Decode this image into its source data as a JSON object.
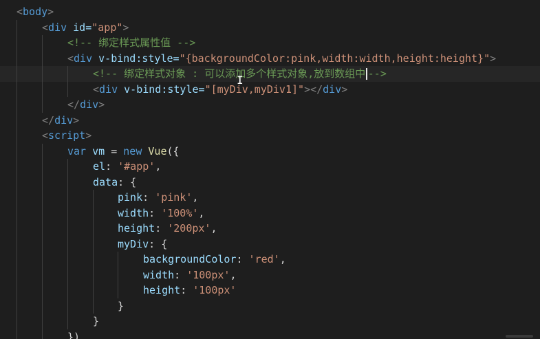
{
  "editor": {
    "lines": [
      {
        "tokens": [
          "<",
          "body",
          ">"
        ]
      },
      {
        "tokens": [
          "<",
          "div",
          " id=",
          "\"app\"",
          ">"
        ]
      },
      {
        "tokens": [
          "<!-- 绑定样式属性值 -->"
        ]
      },
      {
        "tokens": [
          "<",
          "div",
          " v-bind:style=",
          "\"{backgroundColor:pink,width:width,height:height}\"",
          ">"
        ]
      },
      {
        "tokens": [
          "<!-- 绑定样式对象 : 可以添加多个样式对象,放到数组中",
          "-->"
        ]
      },
      {
        "tokens": [
          "<",
          "div",
          " v-bind:style=",
          "\"[myDiv,myDiv1]\"",
          "></",
          "div",
          ">"
        ]
      },
      {
        "tokens": [
          "</",
          "div",
          ">"
        ]
      },
      {
        "tokens": [
          "</",
          "div",
          ">"
        ]
      },
      {
        "tokens": [
          "<",
          "script",
          ">"
        ]
      },
      {
        "tokens": [
          "var",
          " vm ",
          "=",
          " new ",
          "Vue",
          "({"
        ]
      },
      {
        "tokens": [
          "el",
          ": ",
          "'#app'",
          ","
        ]
      },
      {
        "tokens": [
          "data",
          ": {"
        ]
      },
      {
        "tokens": [
          "pink",
          ": ",
          "'pink'",
          ","
        ]
      },
      {
        "tokens": [
          "width",
          ": ",
          "'100%'",
          ","
        ]
      },
      {
        "tokens": [
          "height",
          ": ",
          "'200px'",
          ","
        ]
      },
      {
        "tokens": [
          "myDiv",
          ": {"
        ]
      },
      {
        "tokens": [
          "backgroundColor",
          ": ",
          "'red'",
          ","
        ]
      },
      {
        "tokens": [
          "width",
          ": ",
          "'100px'",
          ","
        ]
      },
      {
        "tokens": [
          "height",
          ": ",
          "'100px'"
        ]
      },
      {
        "tokens": [
          "}"
        ]
      },
      {
        "tokens": [
          "}"
        ]
      },
      {
        "tokens": [
          "})"
        ]
      }
    ]
  },
  "colors": {
    "background": "#1e1e1e",
    "tag": "#569cd6",
    "attribute": "#9cdcfe",
    "string": "#ce9178",
    "comment": "#6a9955",
    "punctuation": "#808080"
  }
}
